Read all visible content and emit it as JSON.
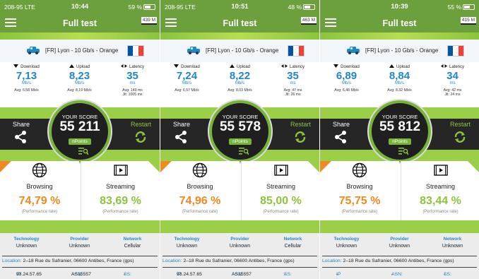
{
  "panels": [
    {
      "status": {
        "carrier": "208-95",
        "net": "LTE",
        "time": "10:44",
        "battery": "59 %"
      },
      "header": {
        "title": "Full test",
        "memory": "439 M"
      },
      "server": {
        "name": "[FR] Lyon - 10 Gb/s - Orange"
      },
      "download": {
        "label": "Download",
        "value": "7,13",
        "unit": "Mb/s",
        "avg": "Avg: 6,58 Mb/s"
      },
      "upload": {
        "label": "Upload",
        "value": "8,23",
        "unit": "Mb/s",
        "avg": "Avg: 8,19 Mb/s"
      },
      "latency": {
        "label": "Latency",
        "value": "35",
        "unit": "ms",
        "avg": "Avg: 149 ms",
        "jit": "Jit: 1005 ms"
      },
      "score": {
        "your_score": "YOUR SCORE",
        "value": "55 211",
        "unit": "nPoints"
      },
      "share_label": "Share",
      "restart_label": "Restart",
      "browsing": {
        "label": "Browsing",
        "value": "74,79 %",
        "sub": "(Performance rate)"
      },
      "streaming": {
        "label": "Streaming",
        "value": "83,69 %",
        "sub": "(Performance rate)"
      },
      "technology": {
        "label": "Technology",
        "value": "Unknown"
      },
      "provider": {
        "label": "Provider",
        "value": "Unknown"
      },
      "network": {
        "label": "Network",
        "value": "Cellular"
      },
      "location": {
        "label": "Location:",
        "value": "2–18 Rue du Safranier, 06600 Antibes, France (gps)"
      },
      "ip": {
        "label": "IP :",
        "value": "93.24.57.65"
      },
      "asn": {
        "label": "ASN:",
        "value": "AS15557"
      },
      "ss": {
        "label": "SS:",
        "value": "-"
      }
    },
    {
      "status": {
        "carrier": "208-95",
        "net": "LTE",
        "time": "10:51",
        "battery": "48 %"
      },
      "header": {
        "title": "Full test",
        "memory": "463 M"
      },
      "server": {
        "name": "[FR] Lyon - 10 Gb/s - Orange"
      },
      "download": {
        "label": "Download",
        "value": "7,24",
        "unit": "Mb/s",
        "avg": "Avg: 6,57 Mb/s"
      },
      "upload": {
        "label": "Upload",
        "value": "8,22",
        "unit": "Mb/s",
        "avg": "Avg: 8,03 Mb/s"
      },
      "latency": {
        "label": "Latency",
        "value": "35",
        "unit": "ms",
        "avg": "Avg: 47 ms",
        "jit": "Jit: 26 ms"
      },
      "score": {
        "your_score": "YOUR SCORE",
        "value": "55 578",
        "unit": "nPoints"
      },
      "share_label": "Share",
      "restart_label": "Restart",
      "browsing": {
        "label": "Browsing",
        "value": "74,96 %",
        "sub": "(Performance rate)"
      },
      "streaming": {
        "label": "Streaming",
        "value": "85,00 %",
        "sub": "(Performance rate)"
      },
      "technology": {
        "label": "Technology",
        "value": "Unknown"
      },
      "provider": {
        "label": "Provider",
        "value": "Unknown"
      },
      "network": {
        "label": "Network",
        "value": "Cellular"
      },
      "location": {
        "label": "Location:",
        "value": "2–18 Rue du Safranier, 06600 Antibes, France (gps)"
      },
      "ip": {
        "label": "IP :",
        "value": "93.24.57.65"
      },
      "asn": {
        "label": "ASN:",
        "value": "AS15557"
      },
      "ss": {
        "label": "SS:",
        "value": "-"
      }
    },
    {
      "status": {
        "carrier": "",
        "net": "",
        "time": "10:39",
        "battery": "55 %"
      },
      "header": {
        "title": "Full test",
        "memory": "415 M"
      },
      "server": {
        "name": "[FR] Lyon - 10 Gb/s - Orange"
      },
      "download": {
        "label": "Download",
        "value": "6,89",
        "unit": "Mb/s",
        "avg": "Avg: 6,48 Mb/s"
      },
      "upload": {
        "label": "Upload",
        "value": "8,84",
        "unit": "Mb/s",
        "avg": "Avg: 8,32 Mb/s"
      },
      "latency": {
        "label": "Latency",
        "value": "34",
        "unit": "ms",
        "avg": "Avg: 42 ms",
        "jit": "Jit: 24 ms"
      },
      "score": {
        "your_score": "YOUR SCORE",
        "value": "55 812",
        "unit": "nPoints"
      },
      "share_label": "Share",
      "restart_label": "Restart",
      "browsing": {
        "label": "Browsing",
        "value": "75,75 %",
        "sub": "(Performance rate)"
      },
      "streaming": {
        "label": "Streaming",
        "value": "83,44 %",
        "sub": "(Performance rate)"
      },
      "technology": {
        "label": "Technology",
        "value": "Unknown"
      },
      "provider": {
        "label": "Provider",
        "value": "Unknown"
      },
      "network": {
        "label": "Network",
        "value": "Unknown"
      },
      "location": {
        "label": "Location:",
        "value": "2–18 Rue du Safranier, 06600 Antibes, France (gps)"
      },
      "ip": {
        "label": "IP :",
        "value": "-"
      },
      "asn": {
        "label": "ASN:",
        "value": "-"
      },
      "ss": {
        "label": "SS:",
        "value": "-"
      }
    }
  ],
  "colors": {
    "brand_green": "#6ca03c",
    "lime": "#8cc43c",
    "orange": "#f08a20",
    "blue": "#1e88c8",
    "dark": "#262626"
  },
  "icons": {
    "menu": "hamburger-icon",
    "car": "car-icon",
    "flag": "france-flag-icon",
    "share": "share-icon",
    "restart": "restart-icon",
    "detail": "detail-icon",
    "browsing": "globe-icon",
    "streaming": "play-icon"
  }
}
